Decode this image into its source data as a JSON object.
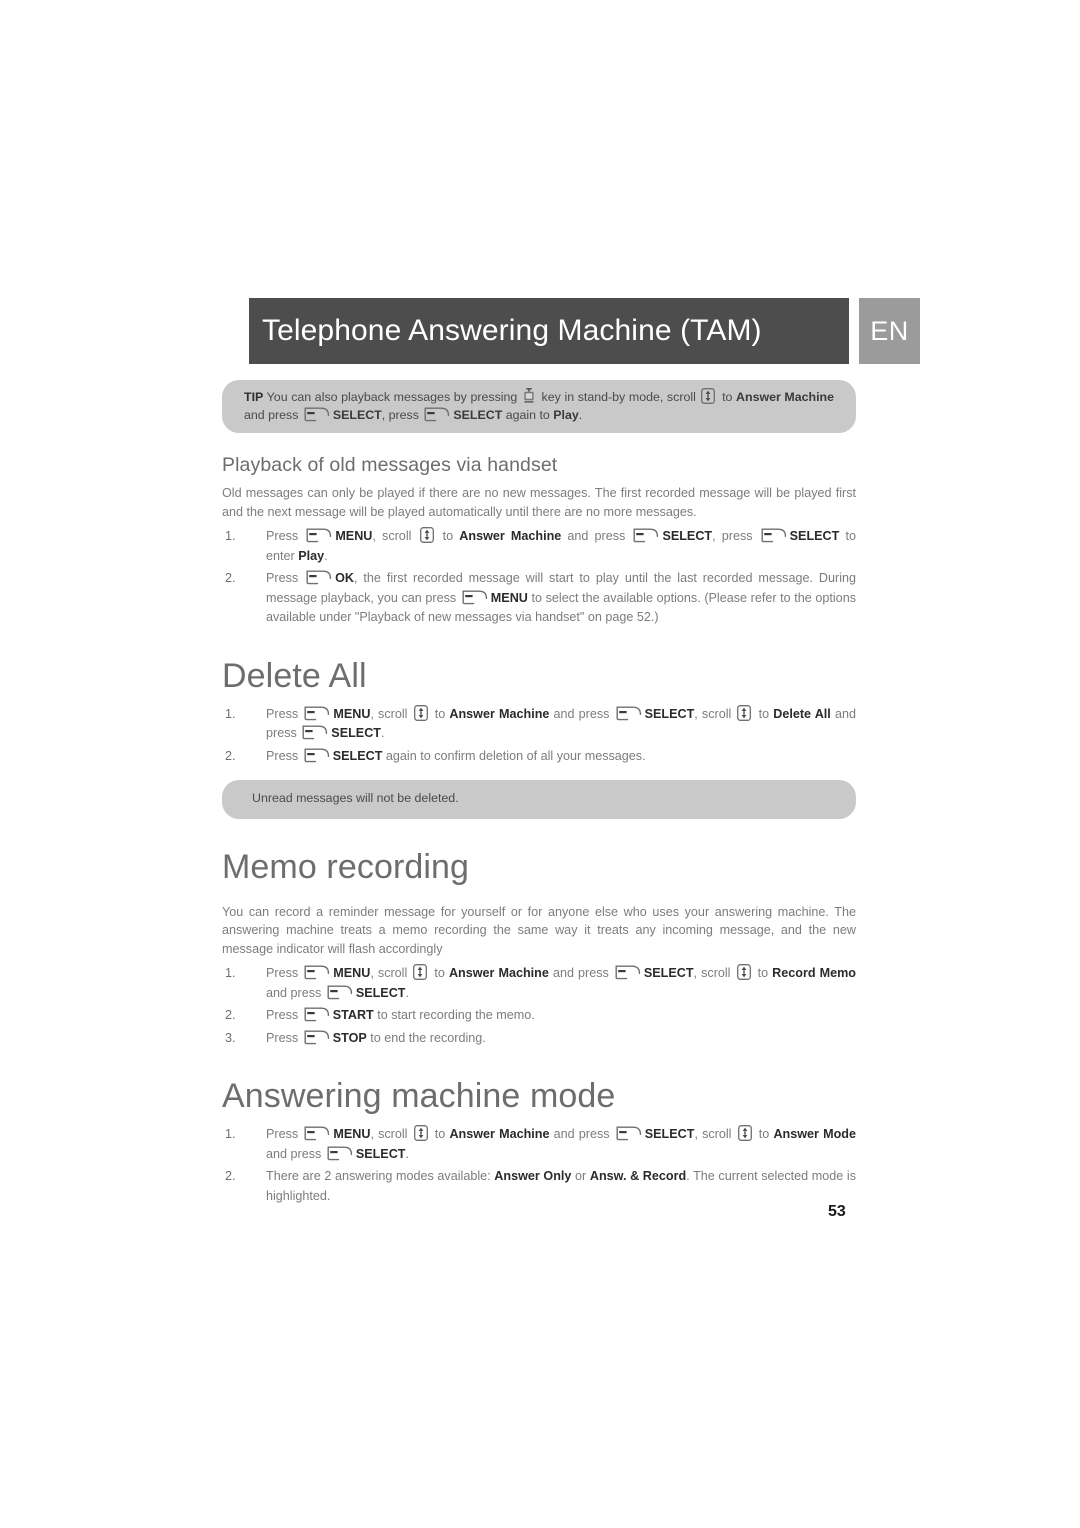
{
  "header": {
    "title": "Telephone Answering Machine (TAM)",
    "language_badge": "EN"
  },
  "tip_box": {
    "label": "TIP",
    "seg1": " You can also playback messages by pressing ",
    "seg2": " key in stand-by mode, scroll ",
    "seg3": " to ",
    "kw1": "Answer Machine",
    "seg4": " and press ",
    "kw2": "SELECT",
    "seg5": ", press ",
    "kw3": "SELECT",
    "seg6": " again to ",
    "kw4": "Play",
    "seg7": "."
  },
  "section_playback": {
    "heading": "Playback of old messages via handset",
    "intro": "Old messages can only be played if there are no new messages. The first recorded message will be played first and the next message will be played automatically until there are no more messages.",
    "steps": [
      {
        "num": "1.",
        "p1": "Press ",
        "k1": "MENU",
        "p2": ", scroll ",
        "p3": " to ",
        "k2": "Answer Machine",
        "p4": " and press ",
        "k3": "SELECT",
        "p5": ", press ",
        "k4": "SELECT",
        "p6": " to enter ",
        "k5": "Play",
        "p7": "."
      },
      {
        "num": "2.",
        "p1": "Press ",
        "k1": "OK",
        "p2": ", the first recorded message will start to play until the last recorded message. During message playback, you can press ",
        "k2": "MENU",
        "p3": " to select the available options. (Please refer to the options available under \"Playback of new messages via handset\" on page 52.)"
      }
    ]
  },
  "section_delete_all": {
    "heading": "Delete All",
    "steps": [
      {
        "num": "1.",
        "p1": "Press ",
        "k1": "MENU",
        "p2": ", scroll ",
        "p3": " to ",
        "k2": "Answer Machine",
        "p4": " and press ",
        "k3": "SELECT",
        "p5": ", scroll ",
        "p6": " to ",
        "k4": "Delete All",
        "p7": " and press ",
        "k5": "SELECT",
        "p8": "."
      },
      {
        "num": "2.",
        "p1": "Press ",
        "k1": "SELECT",
        "p2": " again to confirm deletion of all your messages."
      }
    ],
    "note": "Unread messages will not be deleted."
  },
  "section_memo": {
    "heading": "Memo recording",
    "intro": "You can record a reminder message for yourself or for anyone else who uses your answering machine. The answering machine treats a memo recording the same way it treats any incoming message, and the new message indicator will flash accordingly",
    "steps": [
      {
        "num": "1.",
        "p1": "Press ",
        "k1": "MENU",
        "p2": ", scroll ",
        "p3": " to ",
        "k2": "Answer Machine",
        "p4": " and press ",
        "k3": "SELECT",
        "p5": ", scroll ",
        "p6": " to ",
        "k4": "Record Memo",
        "p7": " and press ",
        "k5": "SELECT",
        "p8": "."
      },
      {
        "num": "2.",
        "p1": "Press ",
        "k1": "START",
        "p2": " to start recording the memo."
      },
      {
        "num": "3.",
        "p1": "Press ",
        "k1": "STOP",
        "p2": " to end the recording."
      }
    ]
  },
  "section_answer_mode": {
    "heading": "Answering machine mode",
    "steps": [
      {
        "num": "1.",
        "p1": "Press ",
        "k1": "MENU",
        "p2": ", scroll ",
        "p3": " to ",
        "k2": "Answer Machine",
        "p4": " and press ",
        "k3": "SELECT",
        "p5": ", scroll ",
        "p6": " to ",
        "k4": "Answer Mode",
        "p7": " and press ",
        "k5": "SELECT",
        "p8": "."
      },
      {
        "num": "2.",
        "p1": "There are 2 answering modes available: ",
        "k1": "Answer Only",
        "p2": " or ",
        "k2": "Answ. & Record",
        "p3": ". The current selected mode is highlighted."
      }
    ]
  },
  "footer": {
    "page_number": "53"
  },
  "colors": {
    "header_bar": "#4d4d4d",
    "lang_badge": "#9b9b9b",
    "callout": "#c9c9c9",
    "heading_text": "#6d6d6d",
    "body_text": "#7c7c7c"
  }
}
